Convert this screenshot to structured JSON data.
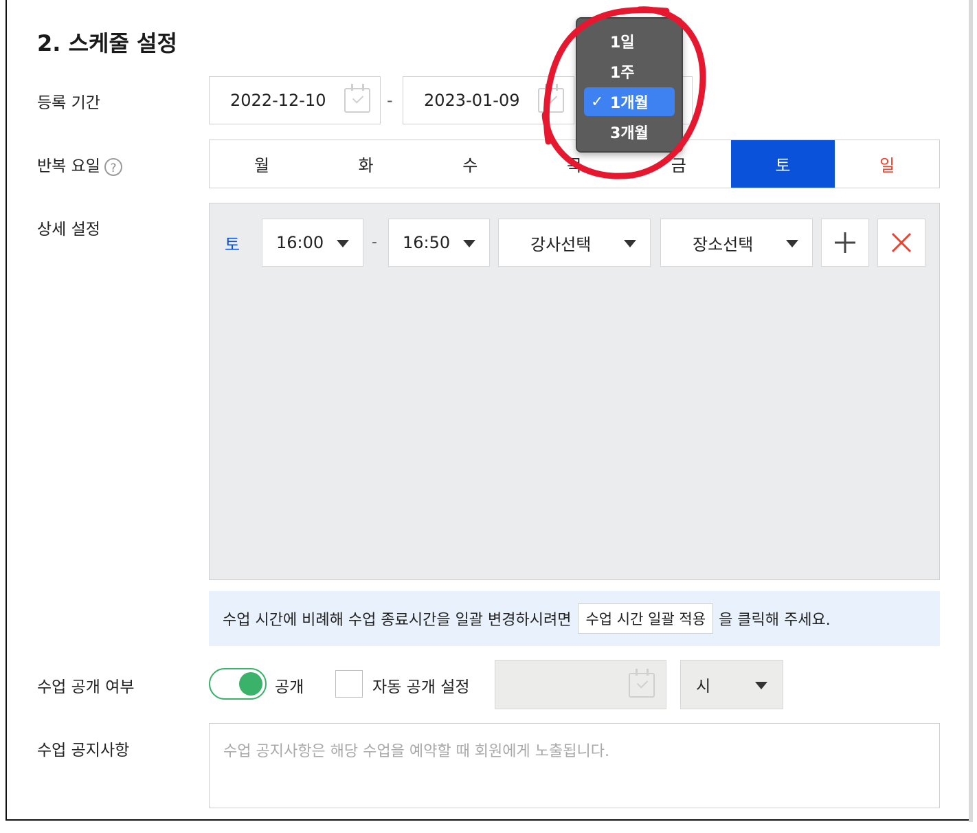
{
  "section_title": "2. 스케줄 설정",
  "labels": {
    "period": "등록 기간",
    "repeat_days": "반복 요일",
    "detail": "상세 설정",
    "visibility": "수업 공개 여부",
    "notice": "수업 공지사항"
  },
  "help_symbol": "?",
  "period": {
    "start_date": "2022-12-10",
    "separator": "-",
    "end_date": "2023-01-09"
  },
  "duration_menu": {
    "items": [
      "1일",
      "1주",
      "1개월",
      "3개월"
    ],
    "selected": "1개월",
    "check": "✓"
  },
  "weekdays": [
    {
      "label": "월",
      "state": "normal"
    },
    {
      "label": "화",
      "state": "normal"
    },
    {
      "label": "수",
      "state": "normal"
    },
    {
      "label": "목",
      "state": "normal"
    },
    {
      "label": "금",
      "state": "normal"
    },
    {
      "label": "토",
      "state": "selected"
    },
    {
      "label": "일",
      "state": "sunday"
    }
  ],
  "detail_row": {
    "day": "토",
    "start_time": "16:00",
    "separator": "-",
    "end_time": "16:50",
    "instructor": "강사선택",
    "location": "장소선택"
  },
  "bulk_notice": {
    "before": "수업 시간에 비례해 수업 종료시간을 일괄 변경하시려면",
    "button": "수업 시간 일괄 적용",
    "after": "을 클릭해 주세요."
  },
  "visibility": {
    "toggle_on": true,
    "toggle_label": "공개",
    "auto_checked": false,
    "auto_label": "자동 공개 설정",
    "hour_value": "시"
  },
  "notice_placeholder": "수업 공지사항은 해당 수업을 예약할 때 회원에게 노출됩니다.",
  "colors": {
    "accent_blue": "#0a52d9",
    "sunday_red": "#e8432e",
    "toggle_green": "#3bb26a",
    "menu_highlight": "#3d82f0",
    "annotation_red": "#e5182f"
  }
}
